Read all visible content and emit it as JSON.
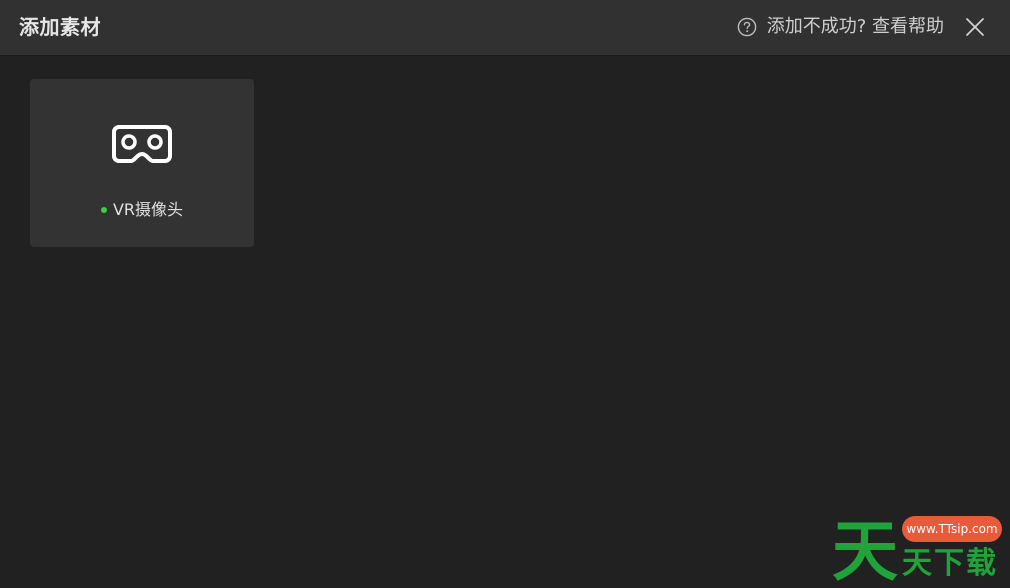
{
  "dialog": {
    "title": "添加素材",
    "help_text": "添加不成功? 查看帮助"
  },
  "sources": [
    {
      "label": "VR摄像头",
      "icon": "vr-headset-icon",
      "status_color": "#3ad13a"
    }
  ],
  "watermark": {
    "big_char": "天",
    "pill_text": "www.TTsip.com",
    "small_text": "天下载"
  },
  "colors": {
    "background": "#212121",
    "header": "#313131",
    "card": "#333333",
    "text": "#e6e6e6",
    "watermark_green": "#1fa33a",
    "watermark_red": "#e85a3c"
  }
}
